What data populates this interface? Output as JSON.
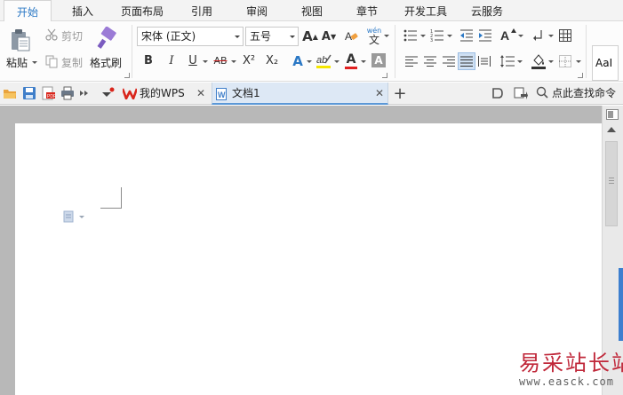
{
  "menu": {
    "tabs": [
      {
        "label": "开始",
        "active": true
      },
      {
        "label": "插入"
      },
      {
        "label": "页面布局"
      },
      {
        "label": "引用"
      },
      {
        "label": "审阅"
      },
      {
        "label": "视图"
      },
      {
        "label": "章节"
      },
      {
        "label": "开发工具"
      },
      {
        "label": "云服务"
      }
    ]
  },
  "ribbon": {
    "paste_label": "粘贴",
    "cut_label": "剪切",
    "copy_label": "复制",
    "format_painter_label": "格式刷",
    "font_name": "宋体 (正文)",
    "font_size": "五号",
    "bold_glyph": "B",
    "italic_glyph": "I",
    "underline_glyph": "U",
    "strikethrough_glyph": "AB",
    "superscript_glyph": "X²",
    "subscript_glyph": "X₂",
    "text_effect_glyph": "A",
    "font_color_glyph": "A",
    "char_shading_glyph": "A",
    "grow_font_glyph": "A",
    "shrink_font_glyph": "A",
    "phonetic_top": "wén",
    "phonetic_bottom": "文",
    "style_preview": "AaI"
  },
  "doc_tabs": {
    "wps_home_label": "我的WPS",
    "document_label": "文档1",
    "search_label": "点此查找命令"
  },
  "watermark": {
    "text_cn": "易采站长站",
    "text_url": "www.easck.com"
  },
  "colors": {
    "accent_blue": "#2b78c5",
    "highlight_yellow": "#f5e600",
    "font_color_red": "#e02020",
    "wps_red": "#d9261c",
    "scroll_accent": "#3d7fcf"
  }
}
